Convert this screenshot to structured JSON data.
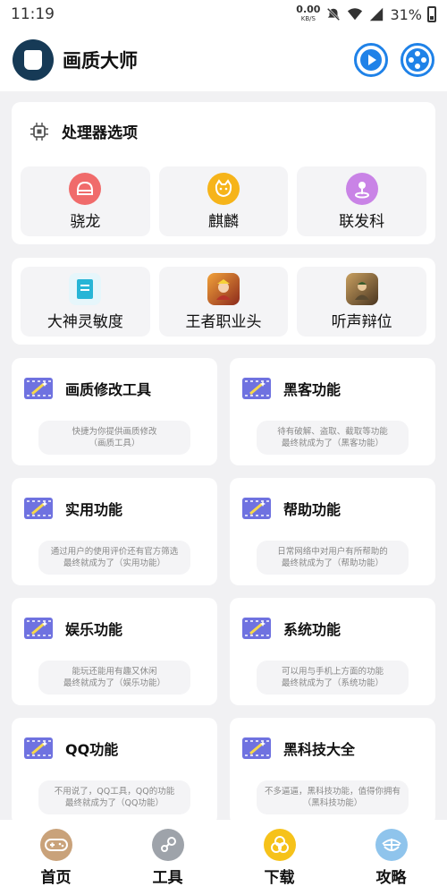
{
  "status_bar": {
    "time": "11:19",
    "net_speed": "0.00",
    "net_unit": "KB/S",
    "battery": "31%"
  },
  "header": {
    "title": "画质大师",
    "logo_icon": "book-icon",
    "actions": [
      "play-icon",
      "gamepad-icon"
    ]
  },
  "processor": {
    "title": "处理器选项",
    "items": [
      {
        "label": "骁龙",
        "icon": "snapdragon-icon",
        "color": "#f06b6b"
      },
      {
        "label": "麒麟",
        "icon": "kirin-icon",
        "color": "#f6b41a"
      },
      {
        "label": "联发科",
        "icon": "mediatek-icon",
        "color": "#c983e6"
      }
    ]
  },
  "games": [
    {
      "label": "大神灵敏度",
      "icon": "sensitivity-icon"
    },
    {
      "label": "王者职业头",
      "icon": "honor-of-kings-icon"
    },
    {
      "label": "听声辩位",
      "icon": "pubg-icon"
    }
  ],
  "features": [
    {
      "title": "画质修改工具",
      "desc1": "快捷为你提供画质修改",
      "desc2": "（画质工具）"
    },
    {
      "title": "黑客功能",
      "desc1": "待有破解、盗取、截取等功能",
      "desc2": "最终就成为了（黑客功能）"
    },
    {
      "title": "实用功能",
      "desc1": "通过用户的使用评价还有官方筛选",
      "desc2": "最终就成为了（实用功能）"
    },
    {
      "title": "帮助功能",
      "desc1": "日常网络中对用户有所帮助的",
      "desc2": "最终就成为了（帮助功能）"
    },
    {
      "title": "娱乐功能",
      "desc1": "能玩还能用有趣又休闲",
      "desc2": "最终就成为了（娱乐功能）"
    },
    {
      "title": "系统功能",
      "desc1": "可以用与手机上方面的功能",
      "desc2": "最终就成为了（系统功能）"
    },
    {
      "title": "QQ功能",
      "desc1": "不用说了，QQ工具，QQ的功能",
      "desc2": "最终就成为了（QQ功能）"
    },
    {
      "title": "黑科技大全",
      "desc1": "不多逼逼，黑科技功能，值得你拥有",
      "desc2": "（黑科技功能）"
    }
  ],
  "bottom_nav": [
    {
      "label": "首页",
      "icon": "gamepad-icon",
      "color": "#c9a27a"
    },
    {
      "label": "工具",
      "icon": "steam-icon",
      "color": "#9ea3aa"
    },
    {
      "label": "下载",
      "icon": "rings-icon",
      "color": "#f6c21a"
    },
    {
      "label": "攻略",
      "icon": "compass-icon",
      "color": "#8fc4ec"
    }
  ],
  "colors": {
    "accent": "#1f82e8",
    "feature_icon": "#6f72e0",
    "background": "#f1f1f3"
  }
}
